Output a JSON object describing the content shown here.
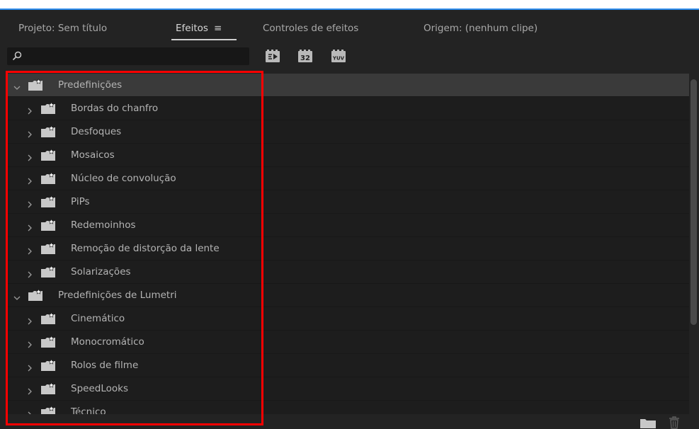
{
  "tabs": [
    {
      "label": "Projeto: Sem título",
      "active": false
    },
    {
      "label": "Efeitos",
      "active": true,
      "menu_glyph": "≡"
    },
    {
      "label": "Controles de efeitos",
      "active": false
    },
    {
      "label": "Origem: (nenhum clipe)",
      "active": false
    }
  ],
  "search": {
    "value": "",
    "placeholder": ""
  },
  "filter_buttons": [
    {
      "icon": "accelerated-effects-icon"
    },
    {
      "icon": "32-bit-color-icon",
      "text": "32"
    },
    {
      "icon": "yuv-effects-icon",
      "text": "YUV"
    }
  ],
  "tree": [
    {
      "label": "Predefinições",
      "level": 0,
      "expanded": true,
      "selected": true
    },
    {
      "label": "Bordas do chanfro",
      "level": 1,
      "expanded": false
    },
    {
      "label": "Desfoques",
      "level": 1,
      "expanded": false
    },
    {
      "label": "Mosaicos",
      "level": 1,
      "expanded": false
    },
    {
      "label": "Núcleo de convolução",
      "level": 1,
      "expanded": false
    },
    {
      "label": "PiPs",
      "level": 1,
      "expanded": false
    },
    {
      "label": "Redemoinhos",
      "level": 1,
      "expanded": false
    },
    {
      "label": "Remoção de distorção da lente",
      "level": 1,
      "expanded": false
    },
    {
      "label": "Solarizações",
      "level": 1,
      "expanded": false
    },
    {
      "label": "Predefinições de Lumetri",
      "level": 0,
      "expanded": true
    },
    {
      "label": "Cinemático",
      "level": 1,
      "expanded": false
    },
    {
      "label": "Monocromático",
      "level": 1,
      "expanded": false
    },
    {
      "label": "Rolos de filme",
      "level": 1,
      "expanded": false
    },
    {
      "label": "SpeedLooks",
      "level": 1,
      "expanded": false
    },
    {
      "label": "Técnico",
      "level": 1,
      "expanded": false
    }
  ],
  "bottom_icons": [
    "new-bin-icon",
    "trash-icon"
  ],
  "colors": {
    "accent_blue": "#2d8ceb",
    "highlight_red": "#ff0000",
    "panel_bg": "#1d1d1d",
    "selected_row": "#3a3a3a"
  }
}
